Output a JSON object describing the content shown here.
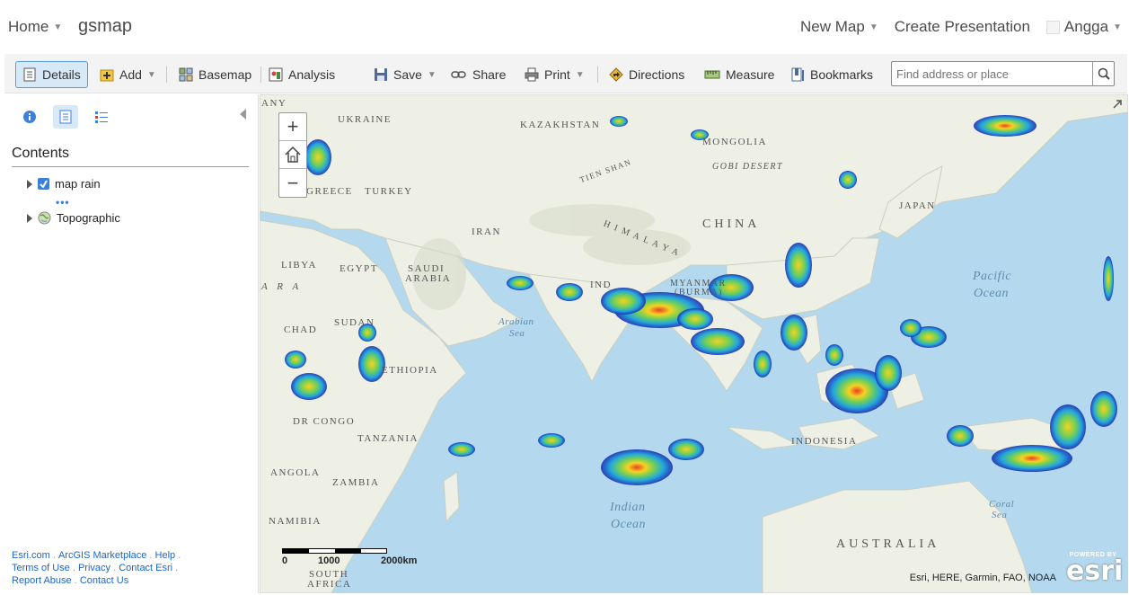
{
  "header": {
    "home_label": "Home",
    "app_title": "gsmap",
    "new_map_label": "New Map",
    "create_presentation_label": "Create Presentation",
    "user_name": "Angga"
  },
  "toolbar": {
    "details": "Details",
    "add": "Add",
    "basemap": "Basemap",
    "analysis": "Analysis",
    "save": "Save",
    "share": "Share",
    "print": "Print",
    "directions": "Directions",
    "measure": "Measure",
    "bookmarks": "Bookmarks",
    "search_placeholder": "Find address or place"
  },
  "panel": {
    "contents_title": "Contents",
    "layers": [
      {
        "name": "map rain",
        "checked": true
      },
      {
        "name": "Topographic"
      }
    ],
    "footer_links": [
      "Esri.com",
      "ArcGIS Marketplace",
      "Help",
      "Terms of Use",
      "Privacy",
      "Contact Esri",
      "Report Abuse",
      "Contact Us"
    ]
  },
  "map": {
    "labels": {
      "ukraine": "UKRAINE",
      "kazakhstan": "KAZAKHSTAN",
      "mongolia": "MONGOLIA",
      "gobi": "GOBI DESERT",
      "tienshan": "TIEN SHAN",
      "china": "CHINA",
      "japan": "JAPAN",
      "greece": "GREECE",
      "turkey": "TURKEY",
      "iran": "IRAN",
      "himalaya": "H I M A L A Y A",
      "libya": "LIBYA",
      "egypt": "EGYPT",
      "saudi": "SAUDI",
      "arabia": "ARABIA",
      "sahara_frag": "A R A",
      "india_frag": "IND",
      "myanmar": "MYANMAR",
      "burma": "(BURMA)",
      "sudan": "SUDAN",
      "chad": "CHAD",
      "ethiopia": "ETHIOPIA",
      "drcongo": "DR CONGO",
      "tanzania": "TANZANIA",
      "angola": "ANGOLA",
      "zambia": "ZAMBIA",
      "namibia": "NAMIBIA",
      "south_africa_1": "SOUTH",
      "south_africa_2": "AFRICA",
      "indonesia": "INDONESIA",
      "australia": "AUSTRALIA",
      "any_frag": "ANY",
      "arabian_sea_1": "Arabian",
      "arabian_sea_2": "Sea",
      "indian_ocean_1": "Indian",
      "indian_ocean_2": "Ocean",
      "pacific_ocean_1": "Pacific",
      "pacific_ocean_2": "Ocean",
      "coral_sea_1": "Coral",
      "coral_sea_2": "Sea"
    },
    "zoom_in": "+",
    "zoom_out": "−",
    "scale_labels": [
      "0",
      "1000",
      "2000km"
    ],
    "attribution": "Esri, HERE, Garmin, FAO, NOAA",
    "esri_powered_by": "POWERED BY",
    "esri_word": "esri"
  },
  "colors": {
    "accent": "#3d7fd9",
    "selected_bg": "#d7e8f7",
    "water": "#b4d9ef",
    "land": "#eef0e6"
  }
}
